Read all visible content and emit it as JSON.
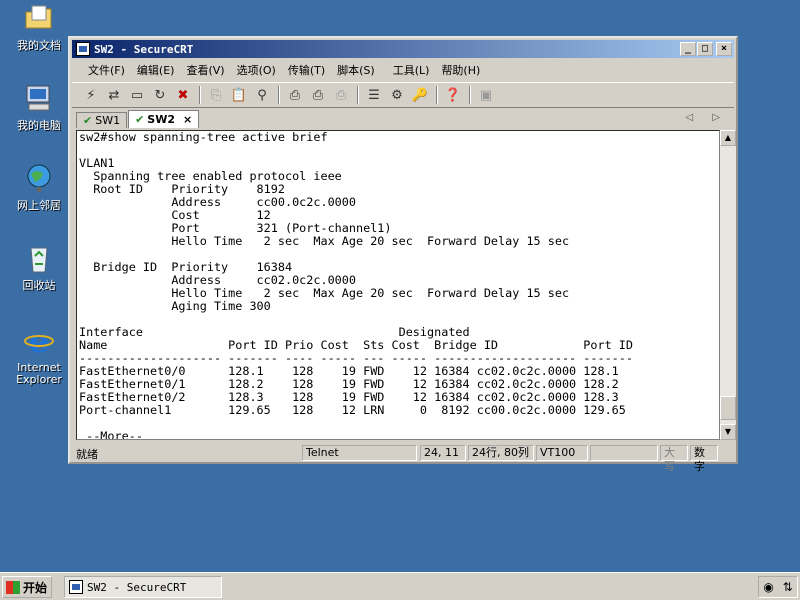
{
  "desktop": {
    "icons": [
      {
        "label": "我的文档"
      },
      {
        "label": "我的电脑"
      },
      {
        "label": "网上邻居"
      },
      {
        "label": "回收站"
      },
      {
        "label": "Internet Explorer"
      }
    ]
  },
  "window": {
    "title": "SW2 - SecureCRT",
    "controls": {
      "minimize": "_",
      "maximize": "□",
      "close": "×"
    }
  },
  "menubar": {
    "items": [
      "文件(F)",
      "编辑(E)",
      "查看(V)",
      "选项(O)",
      "传输(T)",
      "脚本(S)",
      "工具(L)",
      "帮助(H)"
    ]
  },
  "tabs": [
    {
      "label": "SW1",
      "active": false
    },
    {
      "label": "SW2",
      "active": true,
      "close": "×"
    }
  ],
  "tab_arrows": "◁ ▷",
  "terminal": {
    "text": "sw2#show spanning-tree active brief\n\nVLAN1\n  Spanning tree enabled protocol ieee\n  Root ID    Priority    8192\n             Address     cc00.0c2c.0000\n             Cost        12\n             Port        321 (Port-channel1)\n             Hello Time   2 sec  Max Age 20 sec  Forward Delay 15 sec\n\n  Bridge ID  Priority    16384\n             Address     cc02.0c2c.0000\n             Hello Time   2 sec  Max Age 20 sec  Forward Delay 15 sec\n             Aging Time 300\n\nInterface                                    Designated\nName                 Port ID Prio Cost  Sts Cost  Bridge ID            Port ID\n-------------------- ------- ---- ----- --- ----- -------------------- -------\nFastEthernet0/0      128.1    128    19 FWD    12 16384 cc02.0c2c.0000 128.1\nFastEthernet0/1      128.2    128    19 FWD    12 16384 cc02.0c2c.0000 128.2\nFastEthernet0/2      128.3    128    19 FWD    12 16384 cc02.0c2c.0000 128.3\nPort-channel1        129.65   128    12 LRN     0  8192 cc00.0c2c.0000 129.65\n\n --More--"
  },
  "statusbar": {
    "ready": "就绪",
    "protocol": "Telnet",
    "cursor": "24, 11",
    "size": "24行, 80列",
    "emulation": "VT100",
    "caps": "大写",
    "num": "数字"
  },
  "taskbar": {
    "start_label": "开始",
    "task_label": "SW2 - SecureCRT"
  },
  "colors": {
    "desktop": "#3a6ea5",
    "titlebar_start": "#0a246a",
    "titlebar_end": "#a6caf0",
    "chrome": "#d4d0c8"
  }
}
